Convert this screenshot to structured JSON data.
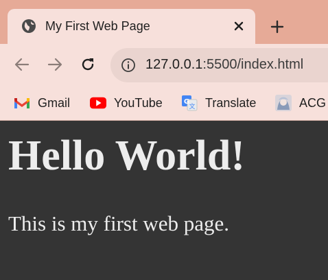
{
  "tab": {
    "title": "My First Web Page",
    "favicon": "globe-icon"
  },
  "toolbar": {
    "url_host": "127.0.0.1",
    "url_path": ":5500/index.html"
  },
  "bookmarks": [
    {
      "label": "Gmail",
      "icon": "gmail-icon"
    },
    {
      "label": "YouTube",
      "icon": "youtube-icon"
    },
    {
      "label": "Translate",
      "icon": "translate-icon"
    },
    {
      "label": "ACG",
      "icon": "acg-icon"
    }
  ],
  "page": {
    "heading": "Hello World!",
    "paragraph": "This is my first web page."
  },
  "colors": {
    "tabstrip": "#e6aa97",
    "toolbar": "#f7e0db",
    "page_background": "#343434",
    "page_text": "#ededed"
  }
}
